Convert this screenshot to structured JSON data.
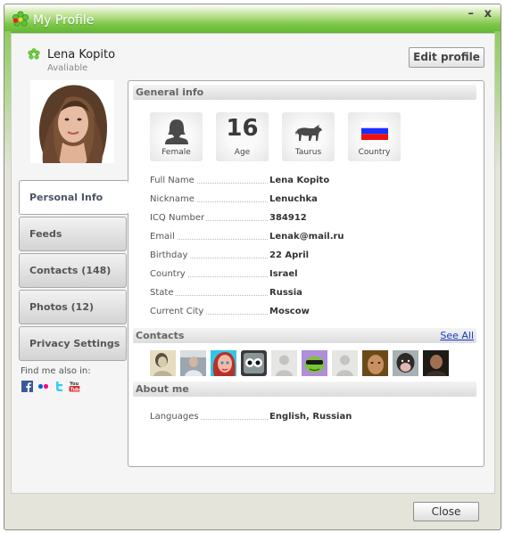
{
  "window": {
    "title": "My Profile",
    "minimize_label": "–",
    "close_label": "x",
    "brand_color": "#59b52a"
  },
  "user": {
    "name": "Lena Kopito",
    "status": "Avaliable",
    "status_icon": "icq-flower-icon"
  },
  "header": {
    "edit_profile_label": "Edit profile"
  },
  "tabs": [
    {
      "label": "Personal Info",
      "active": true
    },
    {
      "label": "Feeds",
      "active": false
    },
    {
      "label": "Contacts (148)",
      "active": false
    },
    {
      "label": "Photos (12)",
      "active": false
    },
    {
      "label": "Privacy Settings",
      "active": false
    }
  ],
  "find_me": {
    "label": "Find me also in:",
    "networks": [
      "facebook-icon",
      "flickr-icon",
      "twitter-icon",
      "youtube-icon"
    ]
  },
  "general_info": {
    "title": "General info",
    "badges": [
      {
        "icon": "female-icon",
        "label": "Female"
      },
      {
        "value": "16",
        "label": "Age"
      },
      {
        "icon": "taurus-bull-icon",
        "label": "Taurus"
      },
      {
        "icon": "russia-flag-icon",
        "label": "Country"
      }
    ],
    "fields": [
      {
        "key": "Full Name",
        "value": "Lena Kopito"
      },
      {
        "key": "Nickname",
        "value": "Lenuchka"
      },
      {
        "key": "ICQ Number",
        "value": "384912"
      },
      {
        "key": "Email",
        "value": "Lenak@mail.ru"
      },
      {
        "key": "Birthday",
        "value": "22 April"
      },
      {
        "key": "Country",
        "value": "Israel"
      },
      {
        "key": "State",
        "value": "Russia"
      },
      {
        "key": "Current City",
        "value": "Moscow"
      }
    ]
  },
  "contacts": {
    "title": "Contacts",
    "see_all_label": "See All",
    "avatars": [
      {
        "type": "photo-vintage-woman"
      },
      {
        "type": "photo-man-office"
      },
      {
        "type": "cartoon-redhead"
      },
      {
        "type": "cartoon-robot"
      },
      {
        "type": "default-silhouette"
      },
      {
        "type": "cartoon-frog"
      },
      {
        "type": "default-silhouette"
      },
      {
        "type": "photo-woman"
      },
      {
        "type": "photo-chimpanzee"
      },
      {
        "type": "photo-man-dark"
      }
    ]
  },
  "about_me": {
    "title": "About me",
    "fields": [
      {
        "key": "Languages",
        "value": "English, Russian"
      }
    ]
  },
  "footer": {
    "close_label": "Close"
  }
}
